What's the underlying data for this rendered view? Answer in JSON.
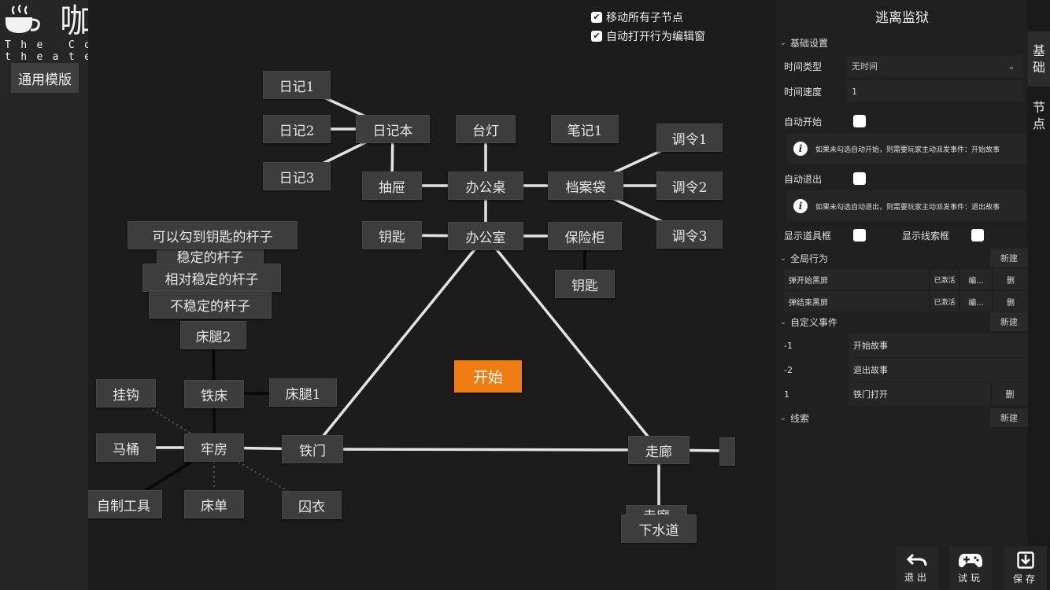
{
  "logo": {
    "title": "咖啡剧场",
    "subtitle": "The Coffee theater"
  },
  "left": {
    "template_button": "通用模版"
  },
  "options": {
    "move_children": "移动所有子节点",
    "auto_open": "自动打开行为编辑窗",
    "move_children_checked": true,
    "auto_open_checked": true
  },
  "graph": {
    "nodes": {
      "n_riji1": "日记1",
      "n_riji2": "日记2",
      "n_riji3": "日记3",
      "n_rijiben": "日记本",
      "n_taideng": "台灯",
      "n_biji1": "笔记1",
      "n_tiaoling1": "调令1",
      "n_tiaoling2": "调令2",
      "n_tiaoling3": "调令3",
      "n_choutì": "抽屉",
      "n_bangongzhuo": "办公桌",
      "n_danganbag": "档案袋",
      "n_yaoshi_a": "钥匙",
      "n_bangongshi": "办公室",
      "n_baoxiangui": "保险柜",
      "n_yaoshi_b": "钥匙",
      "n_gan1": "可以勾到钥匙的杆子",
      "n_gan2": "稳定的杆子",
      "n_gan3": "相对稳定的杆子",
      "n_gan4": "不稳定的杆子",
      "n_chuangtui2": "床腿2",
      "n_guagou": "挂钩",
      "n_tiechuang": "铁床",
      "n_chuangtui1": "床腿1",
      "n_matong": "马桶",
      "n_laofang": "牢房",
      "n_tiemen": "铁门",
      "n_zouláng": "走廊",
      "n_zizhi": "自制工具",
      "n_chuangdan": "床单",
      "n_qiuyi": "囚衣",
      "n_hidden": "走廊",
      "n_xiashuidao": "下水道",
      "n_start": "开始"
    }
  },
  "panel": {
    "title": "逃离监狱",
    "tabs": [
      "基础",
      "节点"
    ],
    "basic": {
      "heading": "基础设置",
      "time_type_label": "时间类型",
      "time_type_value": "无时间",
      "time_speed_label": "时间速度",
      "time_speed_value": "1",
      "auto_start_label": "自动开始",
      "auto_start_info": "如果未勾选自动开始，则需要玩家主动派发事件：开始故事",
      "auto_exit_label": "自动退出",
      "auto_exit_info": "如果未勾选自动退出，则需要玩家主动派发事件：退出故事",
      "show_props_label": "显示道具框",
      "show_clues_label": "显示线索框"
    },
    "global": {
      "heading": "全局行为",
      "new": "新建",
      "rows": [
        {
          "name": "弹开始黑屏",
          "status": "已激活",
          "edit": "编...",
          "del": "删"
        },
        {
          "name": "弹结束黑屏",
          "status": "已激活",
          "edit": "编...",
          "del": "删"
        }
      ]
    },
    "events": {
      "heading": "自定义事件",
      "new": "新建",
      "rows": [
        {
          "id": "-1",
          "name": "开始故事",
          "del": ""
        },
        {
          "id": "-2",
          "name": "退出故事",
          "del": ""
        },
        {
          "id": "1",
          "name": "铁门打开",
          "del": "删"
        }
      ]
    },
    "clues": {
      "heading": "线索",
      "new": "新建"
    }
  },
  "bottom": {
    "exit": "退出",
    "play": "试玩",
    "save": "保存"
  },
  "colors": {
    "accent": "#f07d12",
    "node": "#3d3d3d",
    "panel": "#202020"
  }
}
